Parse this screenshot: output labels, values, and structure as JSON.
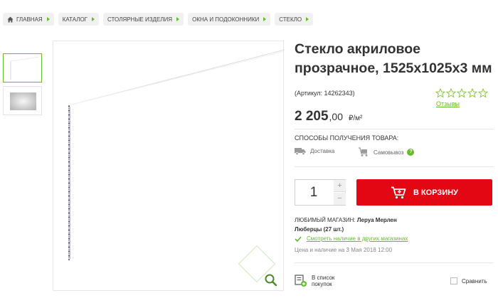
{
  "breadcrumbs": [
    {
      "label": "Главная"
    },
    {
      "label": "Каталог"
    },
    {
      "label": "Столярные изделия"
    },
    {
      "label": "Окна и подоконники"
    },
    {
      "label": "Стекло"
    }
  ],
  "product": {
    "title": "Стекло акриловое прозрачное, 1525x1025x3 мм",
    "sku": "(Артикул: 14262343)",
    "rating_stars": 0,
    "rating_max": 5,
    "reviews_label": "Отзывы",
    "price_main": "2 205",
    "price_cents": ",00",
    "price_unit": "₽/м²"
  },
  "delivery": {
    "heading": "Способы получения товара:",
    "option_delivery": "Доставка",
    "option_pickup": "Самовывоз",
    "help": "?"
  },
  "purchase": {
    "quantity": "1",
    "plus": "+",
    "minus": "−",
    "cart_label": "В корзину"
  },
  "store": {
    "label": "ЛЮБИМЫЙ МАГАЗИН:",
    "name": "Леруа Мерлен Люберцы (27 шт.)",
    "check_link": "Смотреть наличие в других магазинах",
    "timestamp": "Цена и наличие на 3 Мая 2018 12:00"
  },
  "actions": {
    "wishlist_line1": "В список",
    "wishlist_line2": "покупок",
    "compare": "Сравнить"
  },
  "colors": {
    "accent_green": "#66bb2c",
    "cart_red": "#e30613"
  }
}
